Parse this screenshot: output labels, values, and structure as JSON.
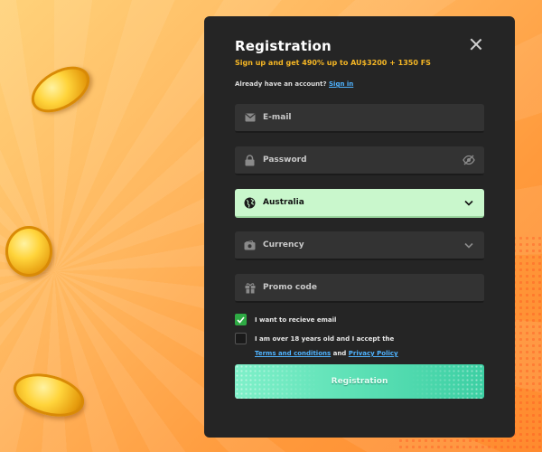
{
  "modal": {
    "title": "Registration",
    "bonus_text": "Sign up and get 490% up to AU$3200 + 1350 FS",
    "have_account_prefix": "Already have an account?",
    "sign_in_label": "Sign in"
  },
  "form": {
    "email_placeholder": "E-mail",
    "password_placeholder": "Password",
    "country_value": "Australia",
    "currency_placeholder": "Currency",
    "promo_placeholder": "Promo code"
  },
  "checkboxes": {
    "email_opt_in_label": "I want to recieve email",
    "email_opt_in_checked": true,
    "age_terms_label": "I am over 18 years old and I accept the",
    "age_terms_checked": false,
    "terms_link": "Terms and conditions",
    "and_text": "and",
    "privacy_link": "Privacy Policy"
  },
  "submit_label": "Registration",
  "colors": {
    "modal_bg": "#252525",
    "accent_yellow": "#f5b625",
    "link_blue": "#4fb3ff",
    "selected_field_bg": "#c9f7cc",
    "check_green": "#2eaa44",
    "submit_gradient": "#5ce0b5"
  },
  "icons": {
    "email": "envelope-icon",
    "password": "lock-icon",
    "password_toggle": "eye-off-icon",
    "country": "globe-icon",
    "country_chevron": "chevron-down-icon",
    "currency": "wallet-icon",
    "currency_chevron": "chevron-down-icon",
    "promo": "gift-icon",
    "close": "close-icon"
  }
}
